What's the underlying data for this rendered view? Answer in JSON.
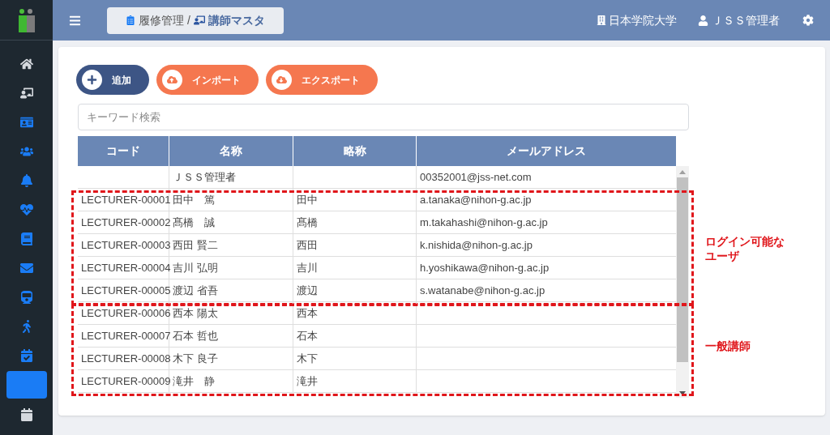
{
  "header": {
    "breadcrumb": [
      {
        "label": "履修管理"
      },
      {
        "label": "講師マスタ"
      }
    ],
    "separator": "/",
    "organization": "日本学院大学",
    "user": "ＪＳＳ管理者"
  },
  "sidebar": {
    "items": [
      {
        "selected": false
      },
      {
        "selected": false
      },
      {
        "selected": false
      },
      {
        "selected": false
      },
      {
        "selected": false
      },
      {
        "selected": false
      },
      {
        "selected": false
      },
      {
        "selected": false
      },
      {
        "selected": false
      },
      {
        "selected": false
      },
      {
        "selected": false
      },
      {
        "selected": true
      },
      {
        "selected": false
      }
    ]
  },
  "toolbar": [
    {
      "kind": "add",
      "label": "追加"
    },
    {
      "kind": "import",
      "label": "インポート"
    },
    {
      "kind": "export",
      "label": "エクスポート"
    }
  ],
  "search": {
    "placeholder": "キーワード検索"
  },
  "table": {
    "columns": [
      "コード",
      "名称",
      "略称",
      "メールアドレス"
    ],
    "row_groups": [
      {
        "rows": [
          {
            "name": "ＪＳＳ管理者",
            "email": "00352001@jss-net.com"
          }
        ]
      },
      {
        "annotation": "ログイン可能なユーザ",
        "rows": [
          {
            "code": "LECTURER-00001",
            "name": "田中　篤",
            "short": "田中",
            "email": "a.tanaka@nihon-g.ac.jp"
          },
          {
            "code": "LECTURER-00002",
            "name": "髙橋　誠",
            "short": "髙橋",
            "email": "m.takahashi@nihon-g.ac.jp"
          },
          {
            "code": "LECTURER-00003",
            "name": "西田 賢二",
            "short": "西田",
            "email": "k.nishida@nihon-g.ac.jp"
          },
          {
            "code": "LECTURER-00004",
            "name": "吉川 弘明",
            "short": "吉川",
            "email": "h.yoshikawa@nihon-g.ac.jp"
          },
          {
            "code": "LECTURER-00005",
            "name": "渡辺 省吾",
            "short": "渡辺",
            "email": "s.watanabe@nihon-g.ac.jp"
          }
        ]
      },
      {
        "annotation": "一般講師",
        "rows": [
          {
            "code": "LECTURER-00006",
            "name": "西本 陽太",
            "short": "西本"
          },
          {
            "code": "LECTURER-00007",
            "name": "石本 哲也",
            "short": "石本"
          },
          {
            "code": "LECTURER-00008",
            "name": "木下 良子",
            "short": "木下"
          },
          {
            "code": "LECTURER-00009",
            "name": "滝井　静",
            "short": "滝井"
          }
        ]
      }
    ]
  }
}
